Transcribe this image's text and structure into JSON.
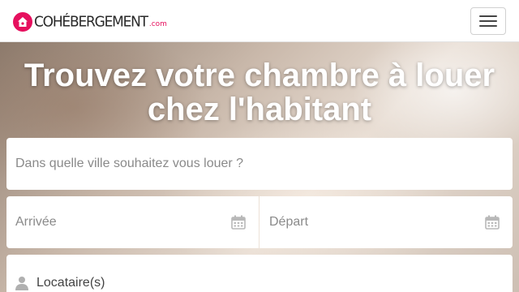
{
  "header": {
    "logo_text": "COHÉBERGEMENT",
    "logo_suffix": ".com",
    "menu_icon": "hamburger-icon"
  },
  "hero": {
    "title": "Trouvez votre chambre à louer chez l'habitant"
  },
  "search": {
    "city_placeholder": "Dans quelle ville souhaitez vous louer ?",
    "arrival_placeholder": "Arrivée",
    "departure_placeholder": "Départ",
    "tenants_label": "Locataire(s)",
    "date_icon": "calendar-icon",
    "tenants_icon": "user-icon"
  },
  "colors": {
    "brand": "#e6105e",
    "text_dark": "#2a2a2a",
    "placeholder": "#8a8a8a"
  }
}
